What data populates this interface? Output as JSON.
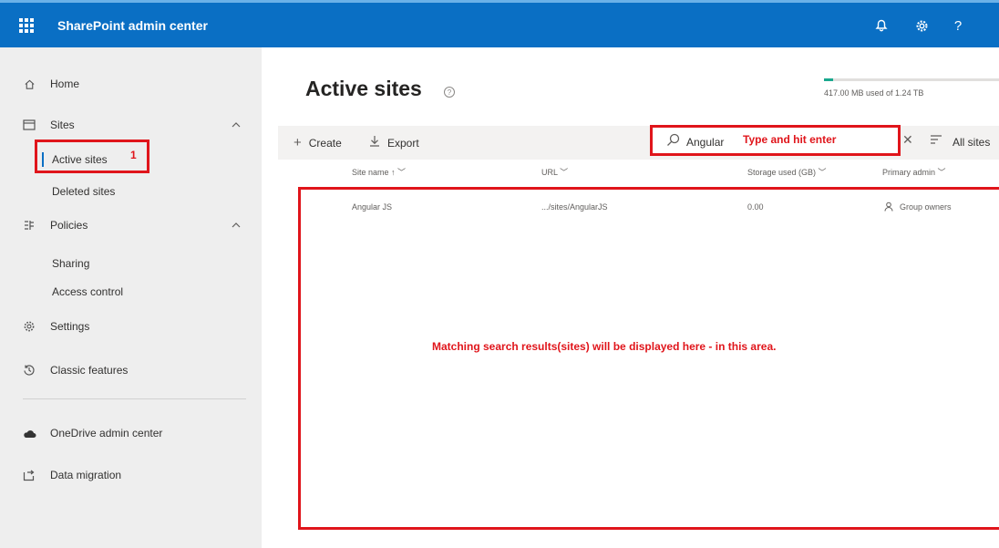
{
  "header": {
    "app_title": "SharePoint admin center",
    "brand_color": "#0a6fc4",
    "icons": [
      "waffle-icon",
      "bell-icon",
      "gear-icon",
      "help-icon"
    ],
    "help_label": "?"
  },
  "sidebar": {
    "items": [
      {
        "label": "Home",
        "icon": "home-icon"
      },
      {
        "label": "Sites",
        "icon": "sites-icon",
        "expanded": true
      },
      {
        "label": "Active sites",
        "selected": true
      },
      {
        "label": "Deleted sites"
      },
      {
        "label": "Policies",
        "icon": "policies-icon",
        "expanded": true
      },
      {
        "label": "Sharing"
      },
      {
        "label": "Access control"
      },
      {
        "label": "Settings",
        "icon": "settings-icon"
      },
      {
        "label": "Classic features",
        "icon": "history-icon"
      },
      {
        "label": "OneDrive admin center",
        "icon": "cloud-icon"
      },
      {
        "label": "Data migration",
        "icon": "migration-icon"
      }
    ],
    "annotation_number": "1"
  },
  "main": {
    "page_title": "Active sites",
    "storage": {
      "text": "417.00 MB used of 1.24 TB",
      "used_fraction": 0.05
    },
    "commands": {
      "create_label": "Create",
      "export_label": "Export",
      "all_sites_label": "All sites"
    },
    "search": {
      "value": "Angular",
      "annotation": "Type and hit enter"
    },
    "table": {
      "columns": [
        "Site name ↑ ﹀",
        "URL ﹀",
        "Storage used (GB) ﹀",
        "Primary admin ﹀"
      ],
      "rows": [
        {
          "site_name": "Angular JS",
          "url": ".../sites/AngularJS",
          "storage": "0.00",
          "admin": "Group owners"
        }
      ]
    },
    "results_annotation": "Matching search results(sites) will be displayed here - in this area."
  },
  "colors": {
    "annotation_red": "#e0151b",
    "storage_green": "#1aa88e"
  }
}
